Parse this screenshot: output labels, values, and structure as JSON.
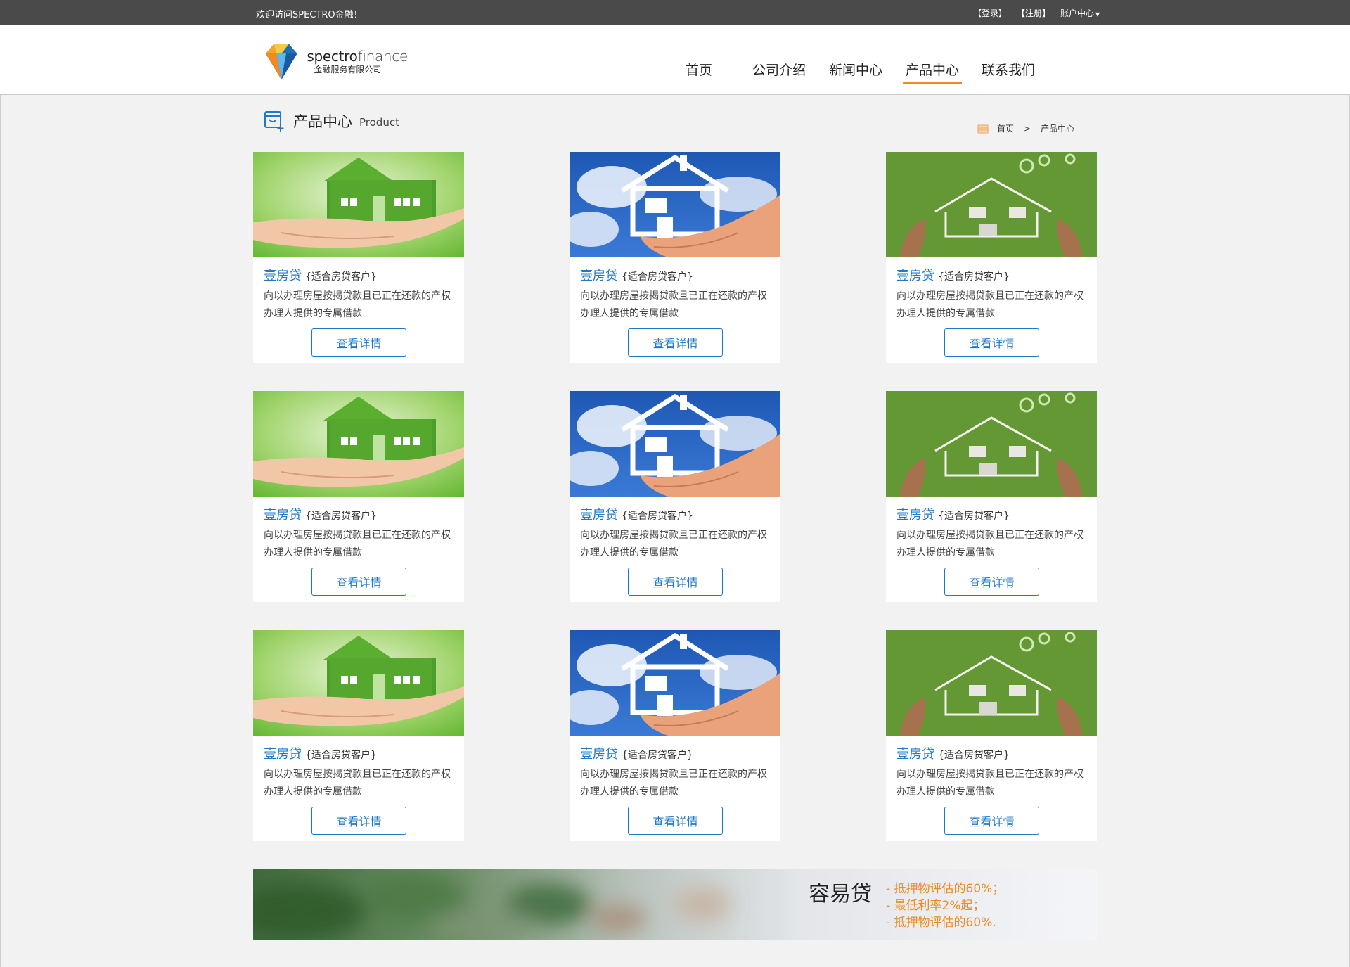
{
  "topbar": {
    "welcome": "欢迎访问SPECTRO金融！",
    "login": "【登录】",
    "register": "【注册】",
    "account": "账户中心"
  },
  "logo": {
    "name_en_1": "spectro",
    "name_en_2": "finance",
    "name_cn": "金融服务有限公司"
  },
  "nav": {
    "items": [
      "首页",
      "公司介绍",
      "新闻中心",
      "产品中心",
      "联系我们"
    ],
    "active": "产品中心"
  },
  "section": {
    "title": "产品中心",
    "subtitle": "Product"
  },
  "breadcrumb": {
    "home": "首页",
    "separator": ">",
    "current": "产品中心"
  },
  "products": [
    {
      "name": "壹房贷",
      "tag": "{适合房贷客户}",
      "desc": "向以办理房屋按揭贷款且已正在还款的产权办理人提供的专属借款",
      "button": "查看详情",
      "image": "green-grass-house-on-palm"
    },
    {
      "name": "壹房贷",
      "tag": "{适合房贷客户}",
      "desc": "向以办理房屋按揭贷款且已正在还款的产权办理人提供的专属借款",
      "button": "查看详情",
      "image": "white-house-outline-on-hand-sky"
    },
    {
      "name": "壹房贷",
      "tag": "{适合房贷客户}",
      "desc": "向以办理房屋按揭贷款且已正在还款的产权办理人提供的专属借款",
      "button": "查看详情",
      "image": "house-drawing-on-grass-with-hands"
    },
    {
      "name": "壹房贷",
      "tag": "{适合房贷客户}",
      "desc": "向以办理房屋按揭贷款且已正在还款的产权办理人提供的专属借款",
      "button": "查看详情",
      "image": "green-grass-house-on-palm"
    },
    {
      "name": "壹房贷",
      "tag": "{适合房贷客户}",
      "desc": "向以办理房屋按揭贷款且已正在还款的产权办理人提供的专属借款",
      "button": "查看详情",
      "image": "white-house-outline-on-hand-sky"
    },
    {
      "name": "壹房贷",
      "tag": "{适合房贷客户}",
      "desc": "向以办理房屋按揭贷款且已正在还款的产权办理人提供的专属借款",
      "button": "查看详情",
      "image": "house-drawing-on-grass-with-hands"
    },
    {
      "name": "壹房贷",
      "tag": "{适合房贷客户}",
      "desc": "向以办理房屋按揭贷款且已正在还款的产权办理人提供的专属借款",
      "button": "查看详情",
      "image": "green-grass-house-on-palm"
    },
    {
      "name": "壹房贷",
      "tag": "{适合房贷客户}",
      "desc": "向以办理房屋按揭贷款且已正在还款的产权办理人提供的专属借款",
      "button": "查看详情",
      "image": "white-house-outline-on-hand-sky"
    },
    {
      "name": "壹房贷",
      "tag": "{适合房贷客户}",
      "desc": "向以办理房屋按揭贷款且已正在还款的产权办理人提供的专属借款",
      "button": "查看详情",
      "image": "house-drawing-on-grass-with-hands"
    }
  ],
  "banner": {
    "title": "容易贷",
    "points": [
      "抵押物评估的60%；",
      "最低利率2%起；",
      "抵押物评估的60%."
    ]
  },
  "colors": {
    "accent_blue": "#1f78c8",
    "accent_orange": "#f08a24",
    "topbar_bg": "#4a4a4a"
  }
}
